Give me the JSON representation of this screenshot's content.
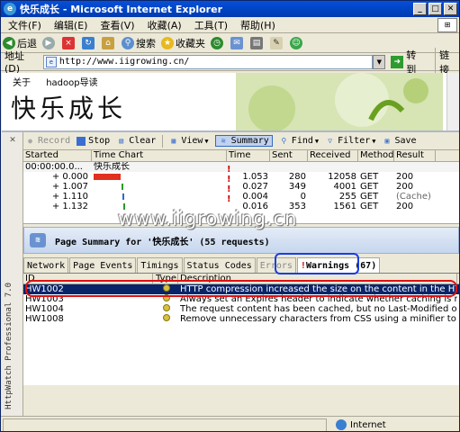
{
  "window": {
    "title": "快乐成长 - Microsoft Internet Explorer"
  },
  "menu": [
    "文件(F)",
    "编辑(E)",
    "查看(V)",
    "收藏(A)",
    "工具(T)",
    "帮助(H)"
  ],
  "toolbar": {
    "back": "后退",
    "search": "搜索",
    "favorites": "收藏夹"
  },
  "address": {
    "label": "地址(D)",
    "url": "http://www.iigrowing.cn/",
    "go": "转到",
    "links": "链接"
  },
  "webpage": {
    "nav": [
      "关于",
      "hadoop导读"
    ],
    "title": "快乐成长"
  },
  "httpwatch": {
    "side_label": "HttpWatch Professional 7.0",
    "toolbar": {
      "record": "Record",
      "stop": "Stop",
      "clear": "Clear",
      "view": "View",
      "summary": "Summary",
      "find": "Find",
      "filter": "Filter",
      "save": "Save"
    },
    "grid": {
      "headers": [
        "Started",
        "Time Chart",
        "Time",
        "Sent",
        "Received",
        "Method",
        "Result"
      ],
      "rows": [
        {
          "started": "00:00:00.0...",
          "chart": "快乐成长",
          "time": "",
          "sent": "",
          "received": "",
          "method": "",
          "result": ""
        },
        {
          "started": "+ 0.000",
          "chart": "",
          "time": "1.053",
          "sent": "280",
          "received": "12058",
          "method": "GET",
          "result": "200"
        },
        {
          "started": "+ 1.007",
          "chart": "",
          "time": "0.027",
          "sent": "349",
          "received": "4001",
          "method": "GET",
          "result": "200"
        },
        {
          "started": "+ 1.110",
          "chart": "",
          "time": "0.004",
          "sent": "0",
          "received": "255",
          "method": "GET",
          "result": "(Cache)"
        },
        {
          "started": "+ 1.132",
          "chart": "",
          "time": "0.016",
          "sent": "353",
          "received": "1561",
          "method": "GET",
          "result": "200"
        }
      ]
    },
    "watermark": "www.iigrowing.cn",
    "page_summary": "Page Summary for '快乐成长' (55 requests)",
    "tabs": [
      "Network",
      "Page Events",
      "Timings",
      "Status Codes",
      "Errors"
    ],
    "warnings_tab": "Warnings (67)",
    "warnings_headers": [
      "ID",
      "Type",
      "Description"
    ],
    "warnings": [
      {
        "id": "HW1002",
        "desc": "HTTP compression increased the size on the content in the HTTP re"
      },
      {
        "id": "HW1003",
        "desc": "Always set an Expires header to indicate whether caching is required"
      },
      {
        "id": "HW1004",
        "desc": "The request content has been cached, but no Last-Modified or ETag"
      },
      {
        "id": "HW1008",
        "desc": "Remove unnecessary characters from CSS using a minifier to decrease"
      }
    ]
  },
  "status": {
    "zone": "Internet"
  }
}
